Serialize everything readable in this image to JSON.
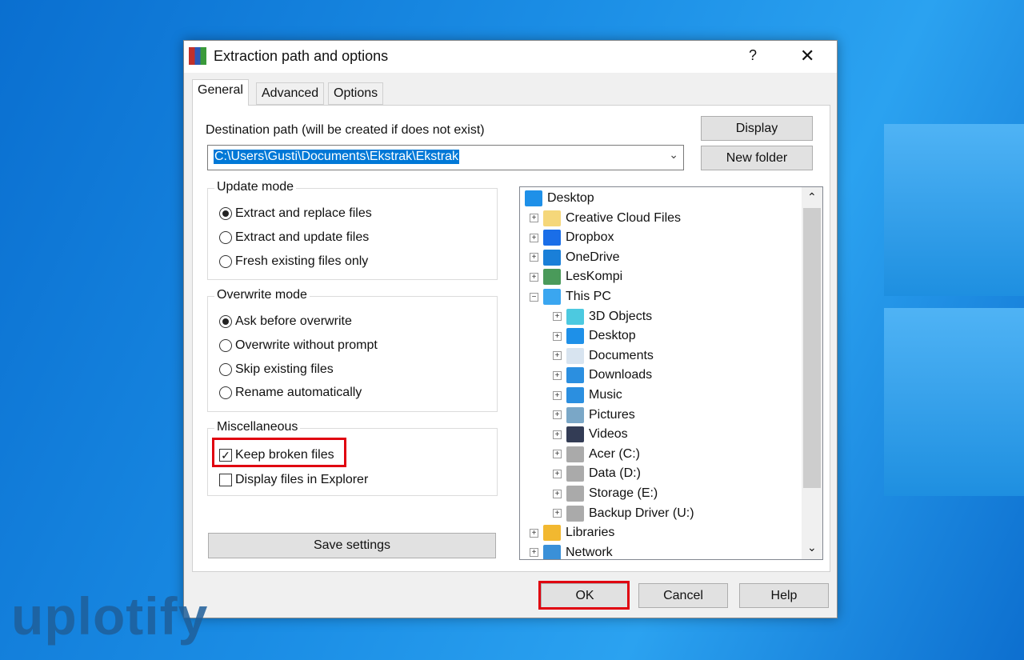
{
  "dialog": {
    "title": "Extraction path and options",
    "help": "?",
    "close": "✕"
  },
  "tabs": [
    {
      "label": "General"
    },
    {
      "label": "Advanced"
    },
    {
      "label": "Options"
    }
  ],
  "destination": {
    "label": "Destination path (will be created if does not exist)",
    "value": "C:\\Users\\Gusti\\Documents\\Ekstrak\\Ekstrak"
  },
  "buttons": {
    "display": "Display",
    "new_folder": "New folder",
    "save_settings": "Save settings",
    "ok": "OK",
    "cancel": "Cancel",
    "help": "Help"
  },
  "update_mode": {
    "label": "Update mode",
    "options": [
      "Extract and replace files",
      "Extract and update files",
      "Fresh existing files only"
    ],
    "selected": 0
  },
  "overwrite_mode": {
    "label": "Overwrite mode",
    "options": [
      "Ask before overwrite",
      "Overwrite without prompt",
      "Skip existing files",
      "Rename automatically"
    ],
    "selected": 0
  },
  "misc": {
    "label": "Miscellaneous",
    "options": [
      {
        "label": "Keep broken files",
        "checked": true
      },
      {
        "label": "Display files in Explorer",
        "checked": false
      }
    ]
  },
  "tree": [
    {
      "label": "Desktop",
      "level": -1,
      "icon": "desktop-icon",
      "color": "#1e90e8"
    },
    {
      "label": "Creative Cloud Files",
      "level": 0,
      "icon": "creative-cloud-icon",
      "color": "#f5d77a"
    },
    {
      "label": "Dropbox",
      "level": 0,
      "icon": "dropbox-icon",
      "color": "#1a6ee8"
    },
    {
      "label": "OneDrive",
      "level": 0,
      "icon": "onedrive-icon",
      "color": "#1a7fd8"
    },
    {
      "label": "LesKompi",
      "level": 0,
      "icon": "user-icon",
      "color": "#4a9a5a"
    },
    {
      "label": "This PC",
      "level": 0,
      "icon": "computer-icon",
      "color": "#3aa6f0",
      "expanded": true
    },
    {
      "label": "3D Objects",
      "level": 1,
      "icon": "3d-objects-icon",
      "color": "#4cc9e0"
    },
    {
      "label": "Desktop",
      "level": 1,
      "icon": "desktop-icon",
      "color": "#1e90e8"
    },
    {
      "label": "Documents",
      "level": 1,
      "icon": "documents-icon",
      "color": "#d8e4f0"
    },
    {
      "label": "Downloads",
      "level": 1,
      "icon": "downloads-icon",
      "color": "#2b8fe0"
    },
    {
      "label": "Music",
      "level": 1,
      "icon": "music-icon",
      "color": "#2b8fe0"
    },
    {
      "label": "Pictures",
      "level": 1,
      "icon": "pictures-icon",
      "color": "#7aa7c7"
    },
    {
      "label": "Videos",
      "level": 1,
      "icon": "videos-icon",
      "color": "#333c55"
    },
    {
      "label": "Acer (C:)",
      "level": 1,
      "icon": "drive-icon",
      "color": "#aaaaaa"
    },
    {
      "label": "Data (D:)",
      "level": 1,
      "icon": "drive-icon",
      "color": "#aaaaaa"
    },
    {
      "label": "Storage (E:)",
      "level": 1,
      "icon": "drive-icon",
      "color": "#aaaaaa"
    },
    {
      "label": "Backup Driver (U:)",
      "level": 1,
      "icon": "drive-icon",
      "color": "#aaaaaa"
    },
    {
      "label": "Libraries",
      "level": 0,
      "icon": "libraries-icon",
      "color": "#f2b830"
    },
    {
      "label": "Network",
      "level": 0,
      "icon": "network-icon",
      "color": "#3a90d8"
    }
  ],
  "watermark": "uplotify",
  "colors": {
    "selection": "#0078d7",
    "highlight": "#e00010",
    "watermark": "#1f5f9a"
  }
}
